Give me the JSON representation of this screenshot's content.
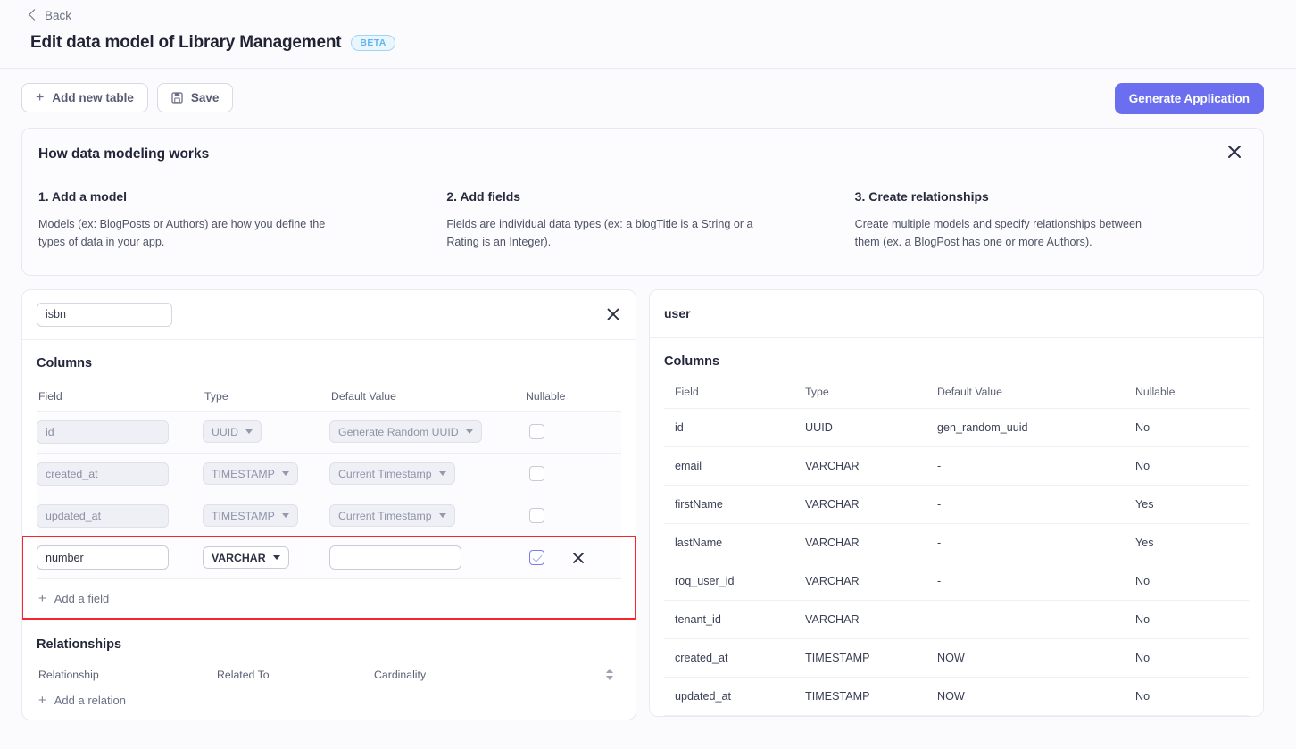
{
  "header": {
    "back_label": "Back",
    "title": "Edit data model of Library Management",
    "beta_badge": "BETA"
  },
  "toolbar": {
    "add_table_label": "Add new table",
    "save_label": "Save",
    "generate_label": "Generate Application"
  },
  "info_panel": {
    "title": "How data modeling works",
    "steps": [
      {
        "heading": "1. Add a model",
        "body": "Models (ex: BlogPosts or Authors) are how you define the types of data in your app."
      },
      {
        "heading": "2. Add fields",
        "body": "Fields are individual data types (ex: a blogTitle is a String or a Rating is an Integer)."
      },
      {
        "heading": "3. Create relationships",
        "body": "Create multiple models and specify relationships between them (ex. a BlogPost has one or more Authors)."
      }
    ]
  },
  "left_panel": {
    "table_name_value": "isbn",
    "columns_label": "Columns",
    "grid_headers": [
      "Field",
      "Type",
      "Default Value",
      "Nullable"
    ],
    "rows": [
      {
        "field": "id",
        "type": "UUID",
        "default": "Generate Random UUID",
        "nullable": false,
        "editable": false
      },
      {
        "field": "created_at",
        "type": "TIMESTAMP",
        "default": "Current Timestamp",
        "nullable": false,
        "editable": false
      },
      {
        "field": "updated_at",
        "type": "TIMESTAMP",
        "default": "Current Timestamp",
        "nullable": false,
        "editable": false
      },
      {
        "field": "number",
        "type": "VARCHAR",
        "default": "",
        "nullable": true,
        "editable": true
      }
    ],
    "add_field_label": "Add a field",
    "relationships_label": "Relationships",
    "relationship_headers": [
      "Relationship",
      "Related To",
      "Cardinality"
    ],
    "add_relation_label": "Add a relation"
  },
  "right_panel": {
    "table_name": "user",
    "columns_label": "Columns",
    "headers": [
      "Field",
      "Type",
      "Default Value",
      "Nullable"
    ],
    "rows": [
      {
        "field": "id",
        "type": "UUID",
        "default": "gen_random_uuid",
        "nullable": "No"
      },
      {
        "field": "email",
        "type": "VARCHAR",
        "default": "-",
        "nullable": "No"
      },
      {
        "field": "firstName",
        "type": "VARCHAR",
        "default": "-",
        "nullable": "Yes"
      },
      {
        "field": "lastName",
        "type": "VARCHAR",
        "default": "-",
        "nullable": "Yes"
      },
      {
        "field": "roq_user_id",
        "type": "VARCHAR",
        "default": "-",
        "nullable": "No"
      },
      {
        "field": "tenant_id",
        "type": "VARCHAR",
        "default": "-",
        "nullable": "No"
      },
      {
        "field": "created_at",
        "type": "TIMESTAMP",
        "default": "NOW",
        "nullable": "No"
      },
      {
        "field": "updated_at",
        "type": "TIMESTAMP",
        "default": "NOW",
        "nullable": "No"
      }
    ]
  },
  "icons": {
    "back": "chevron-left-icon",
    "add": "plus-icon",
    "save": "floppy-disk-icon",
    "close": "close-icon",
    "delete_row": "close-icon",
    "dropdown": "chevron-down-icon",
    "sort": "sort-arrows-icon"
  },
  "colors": {
    "primary": "#6c6ef0",
    "highlight": "#f5262b",
    "beta_text": "#62b6f0",
    "checkbox_checked": "#7b7df2",
    "page_bg": "#fbfbfd"
  }
}
